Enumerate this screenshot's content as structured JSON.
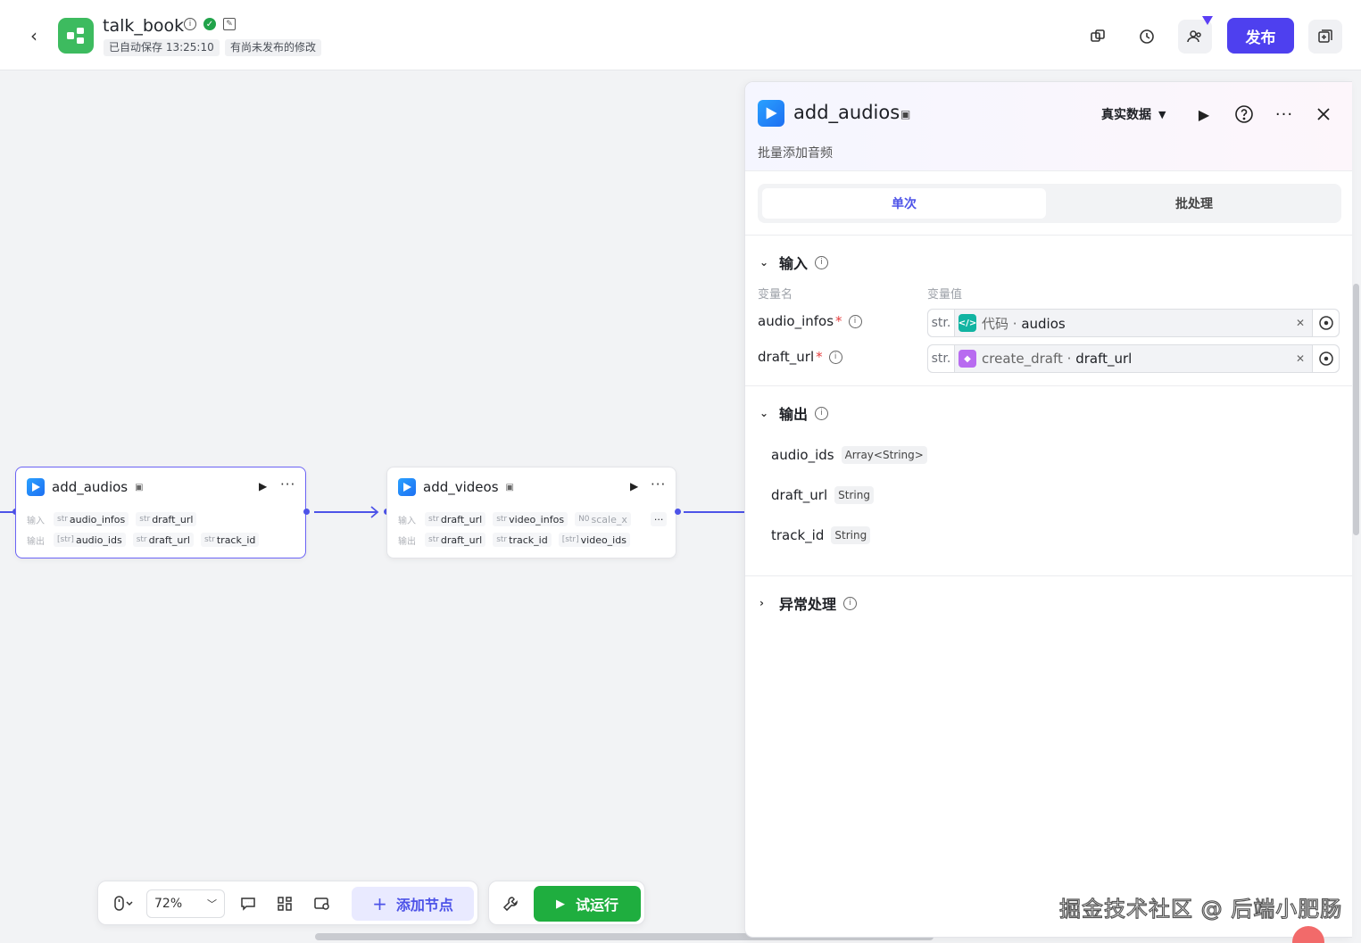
{
  "header": {
    "title": "talk_book",
    "autosave": "已自动保存 13:25:10",
    "unpublished": "有尚未发布的修改",
    "publish_label": "发布"
  },
  "nodes": {
    "audios": {
      "name": "add_audios",
      "in_label": "输入",
      "out_label": "输出",
      "inputs": [
        {
          "type": "str",
          "name": "audio_infos"
        },
        {
          "type": "str",
          "name": "draft_url"
        }
      ],
      "outputs": [
        {
          "type": "[str]",
          "name": "audio_ids"
        },
        {
          "type": "str",
          "name": "draft_url"
        },
        {
          "type": "str",
          "name": "track_id"
        }
      ]
    },
    "videos": {
      "name": "add_videos",
      "in_label": "输入",
      "out_label": "输出",
      "inputs": [
        {
          "type": "str",
          "name": "draft_url"
        },
        {
          "type": "str",
          "name": "video_infos"
        },
        {
          "type": "N0",
          "name": "scale_x"
        }
      ],
      "more": "···",
      "outputs": [
        {
          "type": "str",
          "name": "draft_url"
        },
        {
          "type": "str",
          "name": "track_id"
        },
        {
          "type": "[str]",
          "name": "video_ids"
        }
      ]
    }
  },
  "toolbar": {
    "zoom": "72%",
    "add_node": "添加节点",
    "trial_run": "试运行"
  },
  "panel": {
    "title": "add_audios",
    "description": "批量添加音频",
    "data_select": "真实数据",
    "tabs": {
      "single": "单次",
      "batch": "批处理"
    },
    "input": {
      "heading": "输入",
      "col_name": "变量名",
      "col_value": "变量值",
      "vars": [
        {
          "name": "audio_infos",
          "type": "str.",
          "source_node": "代码",
          "source_sep": " · ",
          "source_var": "audios"
        },
        {
          "name": "draft_url",
          "type": "str.",
          "source_node": "create_draft",
          "source_sep": " · ",
          "source_var": "draft_url"
        }
      ]
    },
    "output": {
      "heading": "输出",
      "vars": [
        {
          "name": "audio_ids",
          "type": "Array<String>"
        },
        {
          "name": "draft_url",
          "type": "String"
        },
        {
          "name": "track_id",
          "type": "String"
        }
      ]
    },
    "exception": {
      "heading": "异常处理"
    }
  },
  "watermark": "掘金技术社区 @ 后端小肥肠",
  "colors": {
    "accent": "#4d53e8",
    "publish": "#4e40ef",
    "run": "#1fae3f",
    "logo": "#3dbb5f"
  }
}
